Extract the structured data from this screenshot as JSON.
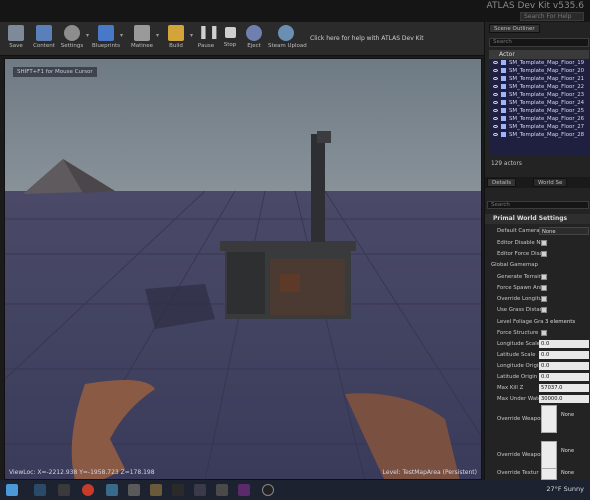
{
  "window": {
    "app_title": "ATLAS Dev Kit v535.6",
    "help_search_placeholder": "Search For Help"
  },
  "toolbar": {
    "buttons": [
      {
        "label": "Save",
        "icon": "save-icon",
        "color": "#7f8a99"
      },
      {
        "label": "Content",
        "icon": "content-icon",
        "color": "#5b7fb8"
      },
      {
        "label": "Settings",
        "icon": "gear-icon",
        "color": "#8d8d8d"
      },
      {
        "label": "Blueprints",
        "icon": "blueprint-icon",
        "color": "#4a78c8"
      },
      {
        "label": "Matinee",
        "icon": "clapper-icon",
        "color": "#9a9a9a"
      },
      {
        "label": "Build",
        "icon": "build-icon",
        "color": "#d4a43a"
      },
      {
        "label": "Pause",
        "icon": "pause-icon",
        "color": "#cfcfcf"
      },
      {
        "label": "Stop",
        "icon": "stop-icon",
        "color": "#cfcfcf"
      },
      {
        "label": "Eject",
        "icon": "eject-icon",
        "color": "#cfcfcf"
      },
      {
        "label": "Steam Upload",
        "icon": "steam-upload-icon",
        "color": "#6a8fb3"
      }
    ],
    "help_text": "Click here for help with ATLAS Dev Kit"
  },
  "viewport": {
    "shift_hint": "SHIFT+F1 for Mouse Cursor",
    "view_location": "ViewLoc: X=-2212.938 Y=-1958.723 Z=178.198",
    "level_label": "Level:",
    "level_name": "TestMapArea (Persistent)"
  },
  "scene_outliner": {
    "tab_label": "Scene Outliner",
    "second_tab": "",
    "filter_placeholder": "Search",
    "column_header": "Actor",
    "actors": [
      "SM_Template_Map_Floor_19",
      "SM_Template_Map_Floor_20",
      "SM_Template_Map_Floor_21",
      "SM_Template_Map_Floor_22",
      "SM_Template_Map_Floor_23",
      "SM_Template_Map_Floor_24",
      "SM_Template_Map_Floor_25",
      "SM_Template_Map_Floor_26",
      "SM_Template_Map_Floor_27",
      "SM_Template_Map_Floor_28"
    ],
    "actor_count": "129 actors"
  },
  "details": {
    "tab_details": "Details",
    "tab_world": "World Se",
    "search_placeholder": "Search",
    "section_title": "Primal World Settings",
    "props": [
      {
        "label": "Default Camera R",
        "kind": "text",
        "value": "None"
      },
      {
        "label": "Editor Disable NPC",
        "kind": "check"
      },
      {
        "label": "Editor Force Disab",
        "kind": "check"
      },
      {
        "label": "Global Gamemap",
        "kind": "header"
      },
      {
        "label": "Generate Terrain",
        "kind": "check"
      },
      {
        "label": "Force Spawn Anim",
        "kind": "check"
      },
      {
        "label": "Override Longitud",
        "kind": "check"
      },
      {
        "label": "Use Grass Distan",
        "kind": "check"
      },
      {
        "label": "Level Foliage Gra",
        "kind": "text",
        "value": "3 elements"
      },
      {
        "label": "Force Structure",
        "kind": "check"
      },
      {
        "label": "Longitude Scale",
        "kind": "value",
        "value": "0.0"
      },
      {
        "label": "Latitude Scale",
        "kind": "value",
        "value": "0.0"
      },
      {
        "label": "Longitude Origin",
        "kind": "value",
        "value": "0.0"
      },
      {
        "label": "Latitude Origin",
        "kind": "value",
        "value": "0.0"
      },
      {
        "label": "Max Kill Z",
        "kind": "value",
        "value": "57037.0"
      },
      {
        "label": "Max Under Wate",
        "kind": "value",
        "value": "30000.0"
      }
    ],
    "textures": [
      {
        "label": "Override Weapon",
        "value": "None"
      },
      {
        "label": "Override Weapon",
        "value": "None"
      },
      {
        "label": "Override Textur",
        "value": "None"
      }
    ]
  },
  "taskbar": {
    "icons": [
      "windows-icon",
      "search-icon",
      "task-view-icon",
      "file-explorer-icon",
      "epic-games-icon",
      "chrome-icon",
      "steam-icon",
      "app-icon",
      "app-icon",
      "app-icon",
      "app-icon",
      "app-icon",
      "unreal-icon"
    ],
    "weather": "27°F Sunny"
  }
}
